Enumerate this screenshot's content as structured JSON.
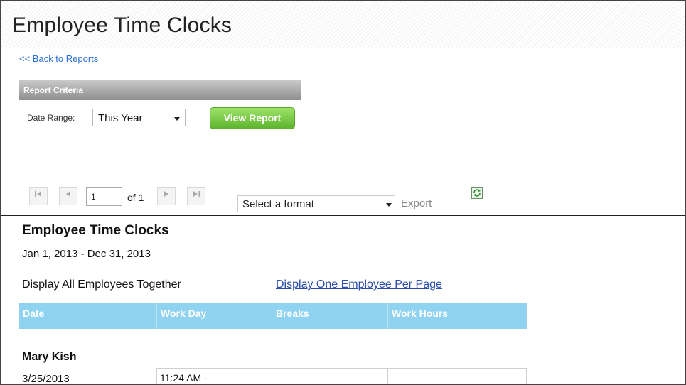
{
  "page": {
    "title": "Employee Time Clocks"
  },
  "nav": {
    "back_label": "<< Back to Reports"
  },
  "criteria": {
    "header": "Report Criteria",
    "date_range_label": "Date Range:",
    "date_range_value": "This Year",
    "view_button_label": "View Report"
  },
  "toolbar": {
    "current_page": "1",
    "page_count_label": "of 1",
    "format_select_value": "Select a format",
    "export_label": "Export",
    "icons": {
      "first": "first-page-icon",
      "prev": "previous-page-icon",
      "next": "next-page-icon",
      "last": "last-page-icon",
      "refresh": "refresh-icon"
    }
  },
  "report": {
    "title": "Employee Time Clocks",
    "range": "Jan 1, 2013 - Dec 31, 2013",
    "display_all_label": "Display All Employees Together",
    "display_one_label": "Display One Employee Per Page",
    "columns": [
      "Date",
      "Work Day",
      "Breaks",
      "Work Hours"
    ],
    "header_color": "#8fd3f1",
    "employees": [
      {
        "name": "Mary Kish",
        "rows": [
          {
            "date": "3/25/2013",
            "work_day": "11:24 AM -",
            "breaks": "",
            "work_hours": ""
          }
        ]
      }
    ]
  }
}
